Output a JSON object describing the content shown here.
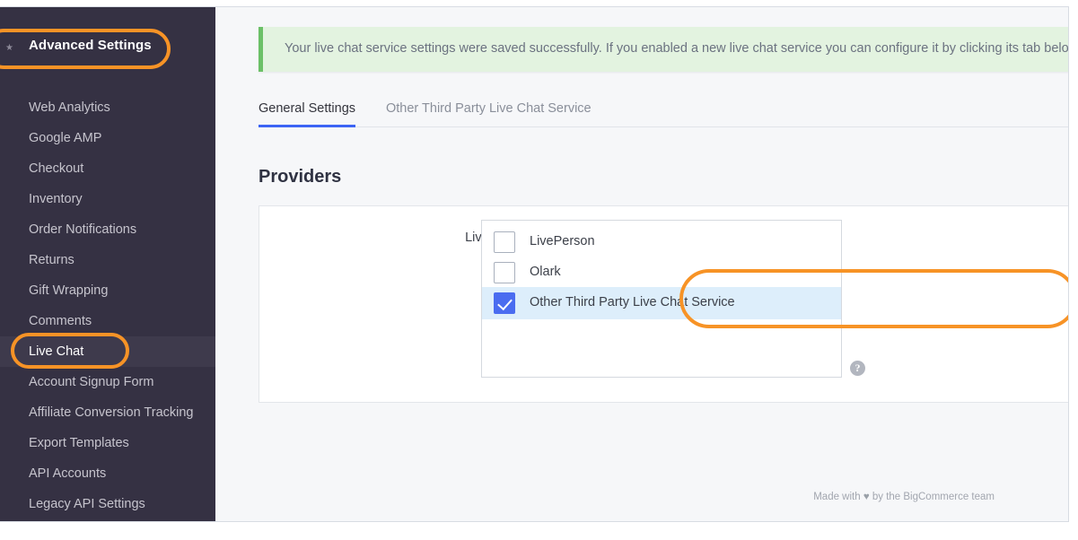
{
  "sidebar": {
    "title": "Advanced Settings",
    "items": [
      {
        "label": "Web Analytics",
        "active": false
      },
      {
        "label": "Google AMP",
        "active": false
      },
      {
        "label": "Checkout",
        "active": false
      },
      {
        "label": "Inventory",
        "active": false
      },
      {
        "label": "Order Notifications",
        "active": false
      },
      {
        "label": "Returns",
        "active": false
      },
      {
        "label": "Gift Wrapping",
        "active": false
      },
      {
        "label": "Comments",
        "active": false
      },
      {
        "label": "Live Chat",
        "active": true
      },
      {
        "label": "Account Signup Form",
        "active": false
      },
      {
        "label": "Affiliate Conversion Tracking",
        "active": false
      },
      {
        "label": "Export Templates",
        "active": false
      },
      {
        "label": "API Accounts",
        "active": false
      },
      {
        "label": "Legacy API Settings",
        "active": false
      }
    ]
  },
  "banner": {
    "message": "Your live chat service settings were saved successfully. If you enabled a new live chat service you can configure it by clicking its tab below.",
    "accent_color": "#6bc067",
    "background_color": "#e3f3e0"
  },
  "tabs": [
    {
      "label": "General Settings",
      "selected": true
    },
    {
      "label": "Other Third Party Live Chat Service",
      "selected": false
    }
  ],
  "main": {
    "heading": "Providers",
    "field_label": "Live Chat Services:",
    "help_icon": "question-mark",
    "options": [
      {
        "label": "LivePerson",
        "checked": false,
        "highlighted": false
      },
      {
        "label": "Olark",
        "checked": false,
        "highlighted": false
      },
      {
        "label": "Other Third Party Live Chat Service",
        "checked": true,
        "highlighted": true
      }
    ]
  },
  "footer": {
    "prefix": "Made with ",
    "heart": "♥",
    "suffix": " by the BigCommerce team"
  },
  "annotations": {
    "color": "#f79326",
    "targets": [
      "Advanced Settings",
      "Live Chat",
      "Other Third Party Live Chat Service"
    ]
  }
}
